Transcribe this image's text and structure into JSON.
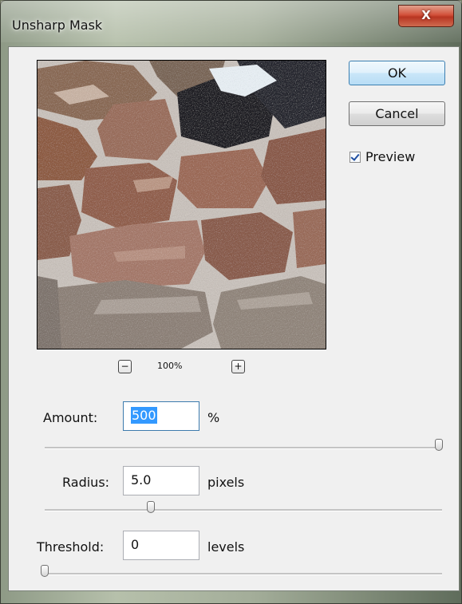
{
  "window": {
    "title": "Unsharp Mask",
    "close_label": "X"
  },
  "buttons": {
    "ok": "OK",
    "cancel": "Cancel"
  },
  "preview_checkbox": {
    "label": "Preview",
    "checked": true
  },
  "zoom": {
    "minus": "−",
    "plus": "+",
    "level": "100%"
  },
  "amount": {
    "label": "Amount:",
    "value": "500",
    "unit": "%",
    "slider_fraction": 1.0
  },
  "radius": {
    "label": "Radius:",
    "value": "5.0",
    "unit": "pixels",
    "slider_fraction": 0.27
  },
  "threshold": {
    "label": "Threshold:",
    "value": "0",
    "unit": "levels",
    "slider_fraction": 0.0
  },
  "colors": {
    "accent": "#3399ff",
    "close_red": "#c2412b"
  }
}
